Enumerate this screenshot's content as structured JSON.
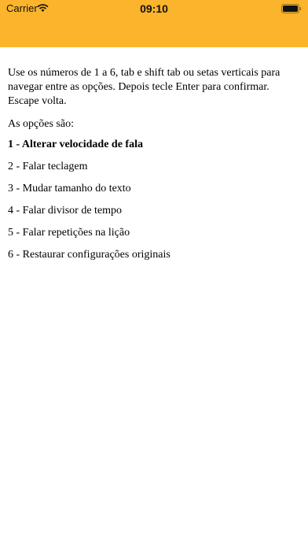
{
  "status_bar": {
    "carrier": "Carrier",
    "time": "09:10",
    "wifi_icon": "wifi-icon",
    "battery_icon": "battery-full-icon"
  },
  "colors": {
    "header_background": "#FBB42B",
    "text": "#000000"
  },
  "screen": {
    "instructions": "Use os números de 1 a 6, tab e shift tab ou setas verticais para navegar entre as opções. Depois tecle Enter para confirmar. Escape volta.",
    "options_heading": "As opções são:",
    "options": [
      {
        "label": "1 - Alterar velocidade de fala",
        "selected": true
      },
      {
        "label": "2 - Falar teclagem",
        "selected": false
      },
      {
        "label": "3 - Mudar tamanho do texto",
        "selected": false
      },
      {
        "label": "4 - Falar divisor de tempo",
        "selected": false
      },
      {
        "label": "5 - Falar repetições na lição",
        "selected": false
      },
      {
        "label": "6 - Restaurar configurações originais",
        "selected": false
      }
    ]
  }
}
